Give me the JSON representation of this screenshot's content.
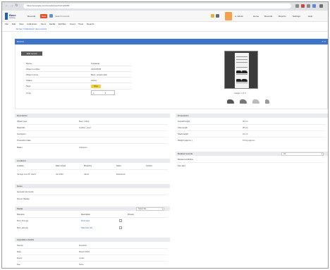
{
  "browser": {
    "url": "https://example.com/records/view?id=123456",
    "nav": {
      "back": "←",
      "forward": "→",
      "reload": "↻"
    }
  },
  "header": {
    "logo_title": "Base",
    "logo_sub": "Catalog",
    "primary_button": "New",
    "secondary_link": "Records",
    "search_placeholder": "Search records",
    "user_label": "A. Admin",
    "menu_links": [
      "Home",
      "Records",
      "Reports",
      "Settings",
      "Help"
    ]
  },
  "menu": {
    "items": [
      "File",
      "Edit",
      "View",
      "Collections",
      "Items",
      "Media",
      "Exhibits",
      "Users",
      "Tools",
      "Reports"
    ],
    "breadcrumb": "Home / Collections / Item record"
  },
  "title_bar": {
    "title": "Record",
    "actions": "× ×"
  },
  "top_panel": {
    "edit_button": "Edit record",
    "fields": [
      {
        "label": "Name",
        "value": "Footwear"
      },
      {
        "label": "Object number",
        "value": "1234.5678"
      },
      {
        "label": "Object name",
        "value": "Boot, ceremonial"
      },
      {
        "label": "Status",
        "value": "Active"
      }
    ],
    "chip_label": "Tags",
    "chip_value": "Shoe",
    "select_label": "Copy",
    "select_value": "1",
    "preview_caption": "Image 1 of 4",
    "thumbnail_count": 4
  },
  "left_sections": [
    {
      "title": "Description",
      "rows": [
        {
          "label": "Object type",
          "value": "Boot, riding"
        },
        {
          "label": "Materials",
          "value": "Leather, wool"
        },
        {
          "label": "Inscription",
          "value": ""
        },
        {
          "label": "Production date",
          "value": ""
        },
        {
          "label": "Maker",
          "value": "Unknown"
        }
      ]
    }
  ],
  "location_table": {
    "title": "Locations",
    "headers": [
      "Location",
      "Date moved",
      "Moved by",
      "Notes",
      "Current"
    ],
    "row": [
      "Storage room B, shelf 4",
      "Jan 2020",
      "Admin",
      "Reshelved",
      ""
    ]
  },
  "note_section": {
    "title": "Notes",
    "rows": [
      "General comments",
      "Not on display"
    ]
  },
  "media_section": {
    "title": "Media",
    "select_label": "Select file...",
    "headers": [
      "Filename",
      "Description",
      "Primary"
    ],
    "rows": [
      {
        "name": "Boot_front.jpg",
        "desc": "Front view"
      },
      {
        "name": "Boot_side.jpg",
        "desc": "Side view, left"
      }
    ]
  },
  "bottom_section": {
    "title": "Acquisition details",
    "rows": [
      {
        "label": "Source",
        "value": "Donation"
      },
      {
        "label": "Date",
        "value": "March 2019"
      },
      {
        "label": "Donor",
        "value": "Jones"
      },
      {
        "label": "Fee",
        "value": "None"
      }
    ]
  },
  "right_sections": [
    {
      "title": "Dimensions",
      "rows": [
        {
          "label": "Overall height",
          "value": "32 cm"
        },
        {
          "label": "Sole length",
          "value": "28 cm"
        },
        {
          "label": "Shaft height",
          "value": "24 cm"
        },
        {
          "label": "Weight (approx.)",
          "value": "0.9 kg approx."
        }
      ]
    }
  ],
  "related_section": {
    "title": "Related records",
    "select_value": "All",
    "rows": [
      "Related exhibition",
      "See also"
    ]
  }
}
